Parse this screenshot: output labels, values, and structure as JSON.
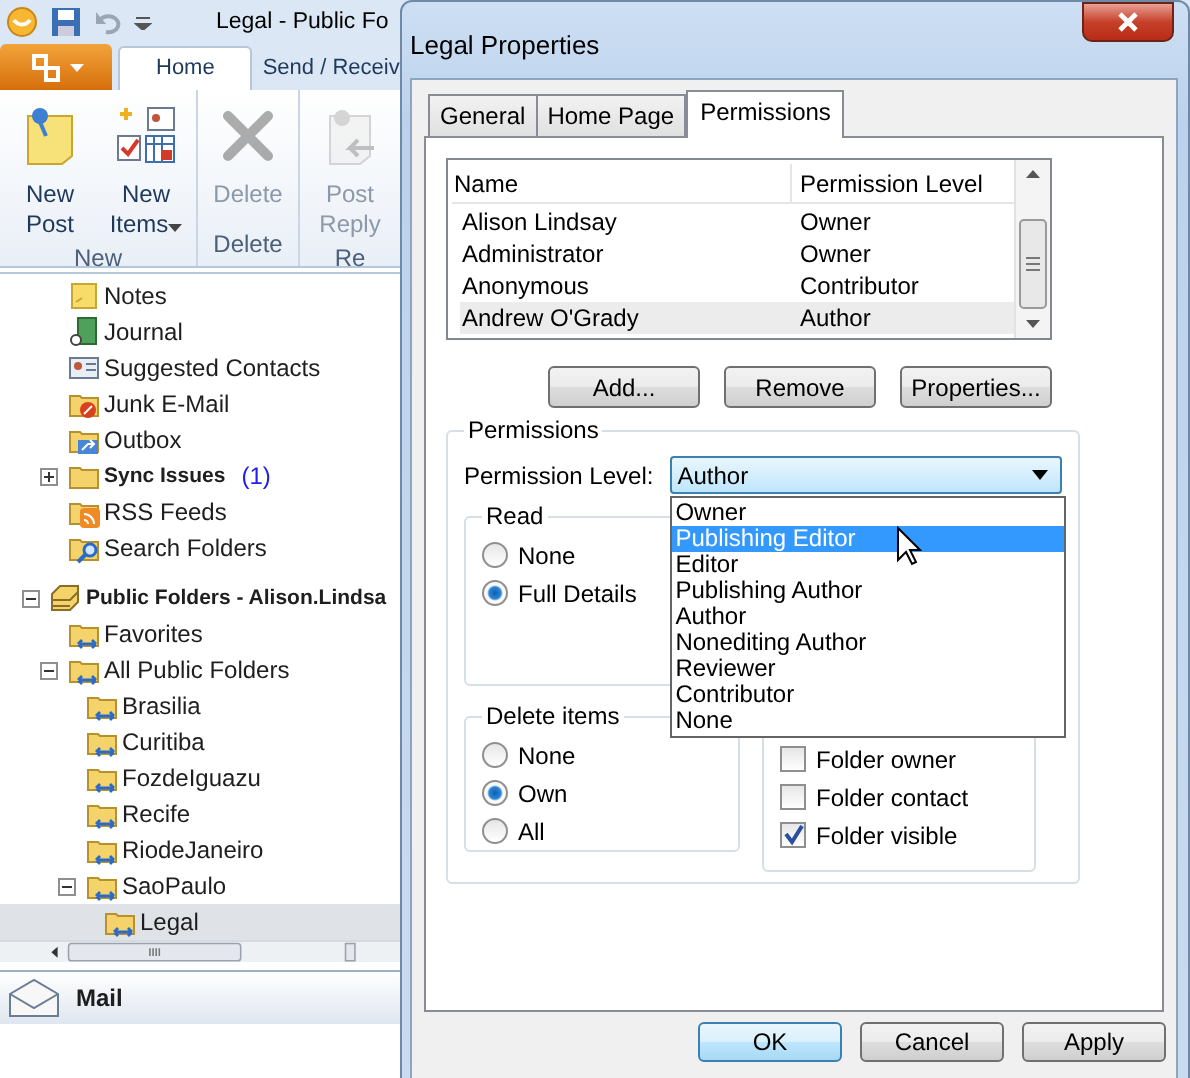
{
  "main_window": {
    "title": "Legal - Public Fo",
    "ribbon_tabs": [
      {
        "label": "Home",
        "selected": true
      },
      {
        "label": "Send / Receiv",
        "selected": false
      }
    ],
    "ribbon_groups": [
      {
        "label": "New",
        "buttons": [
          {
            "label": "New Post",
            "kind": "post",
            "disabled": false,
            "dropdown": false
          },
          {
            "label": "New Items",
            "kind": "items",
            "disabled": false,
            "dropdown": true
          }
        ]
      },
      {
        "label": "Delete",
        "buttons": [
          {
            "label": "Delete",
            "kind": "delete",
            "disabled": true,
            "dropdown": false
          }
        ]
      },
      {
        "label": "Re",
        "buttons": [
          {
            "label": "Post Reply",
            "kind": "reply",
            "disabled": true,
            "dropdown": false
          }
        ]
      }
    ],
    "mailbox_folders": [
      {
        "label": "Notes",
        "kind": "notes",
        "selected": false
      },
      {
        "label": "Journal",
        "kind": "journal",
        "selected": false
      },
      {
        "label": "Suggested Contacts",
        "kind": "contacts",
        "selected": false
      },
      {
        "label": "Junk E-Mail",
        "kind": "junk",
        "selected": false
      },
      {
        "label": "Outbox",
        "kind": "outbox",
        "selected": false
      },
      {
        "label": "Sync Issues",
        "kind": "folder",
        "selected": false,
        "bold": true,
        "count": "(1)",
        "expanded": false
      },
      {
        "label": "RSS Feeds",
        "kind": "rss",
        "selected": false
      },
      {
        "label": "Search Folders",
        "kind": "search",
        "selected": false
      }
    ],
    "public_folders": [
      {
        "label": "Public Folders - Alison.Lindsa",
        "kind": "store",
        "selected": false,
        "bold": true,
        "expanded": true,
        "children": [
          {
            "label": "Favorites",
            "kind": "public",
            "selected": false
          },
          {
            "label": "All Public Folders",
            "kind": "public",
            "selected": false,
            "expanded": true,
            "children": [
              {
                "label": "Brasilia",
                "kind": "public",
                "selected": false
              },
              {
                "label": "Curitiba",
                "kind": "public",
                "selected": false
              },
              {
                "label": "FozdeIguazu",
                "kind": "public",
                "selected": false
              },
              {
                "label": "Recife",
                "kind": "public",
                "selected": false
              },
              {
                "label": "RiodeJaneiro",
                "kind": "public",
                "selected": false
              },
              {
                "label": "SaoPaulo",
                "kind": "public",
                "selected": false,
                "expanded": true,
                "children": [
                  {
                    "label": "Legal",
                    "kind": "public",
                    "selected": true
                  }
                ]
              }
            ]
          }
        ]
      }
    ],
    "mail_button": "Mail"
  },
  "dialog": {
    "title": "Legal Properties",
    "tabs": [
      {
        "label": "General",
        "selected": false
      },
      {
        "label": "Home Page",
        "selected": false
      },
      {
        "label": "Permissions",
        "selected": true
      }
    ],
    "list": {
      "columns": [
        "Name",
        "Permission Level"
      ],
      "rows": [
        {
          "name": "Alison Lindsay",
          "permission": "Owner",
          "selected": false
        },
        {
          "name": "Administrator",
          "permission": "Owner",
          "selected": false
        },
        {
          "name": "Anonymous",
          "permission": "Contributor",
          "selected": false
        },
        {
          "name": "Andrew O'Grady",
          "permission": "Author",
          "selected": true
        }
      ]
    },
    "list_buttons": [
      "Add...",
      "Remove",
      "Properties..."
    ],
    "permissions": {
      "label": "Permissions",
      "level_label": "Permission Level:",
      "level_value": "Author",
      "dropdown_open": true,
      "dropdown_options": [
        {
          "label": "Owner",
          "selected": false
        },
        {
          "label": "Publishing Editor",
          "selected": true
        },
        {
          "label": "Editor",
          "selected": false
        },
        {
          "label": "Publishing Author",
          "selected": false
        },
        {
          "label": "Author",
          "selected": false
        },
        {
          "label": "Nonediting Author",
          "selected": false
        },
        {
          "label": "Reviewer",
          "selected": false
        },
        {
          "label": "Contributor",
          "selected": false
        },
        {
          "label": "None",
          "selected": false
        }
      ],
      "read": {
        "label": "Read",
        "options": [
          {
            "label": "None",
            "selected": false
          },
          {
            "label": "Full Details",
            "selected": true
          }
        ]
      },
      "delete": {
        "label": "Delete items",
        "options": [
          {
            "label": "None",
            "selected": false
          },
          {
            "label": "Own",
            "selected": true
          },
          {
            "label": "All",
            "selected": false
          }
        ]
      },
      "checkboxes": [
        {
          "label": "Folder owner",
          "checked": false
        },
        {
          "label": "Folder contact",
          "checked": false
        },
        {
          "label": "Folder visible",
          "checked": true
        }
      ]
    },
    "buttons": [
      {
        "label": "OK",
        "default": true
      },
      {
        "label": "Cancel",
        "default": false
      },
      {
        "label": "Apply",
        "default": false
      }
    ]
  }
}
